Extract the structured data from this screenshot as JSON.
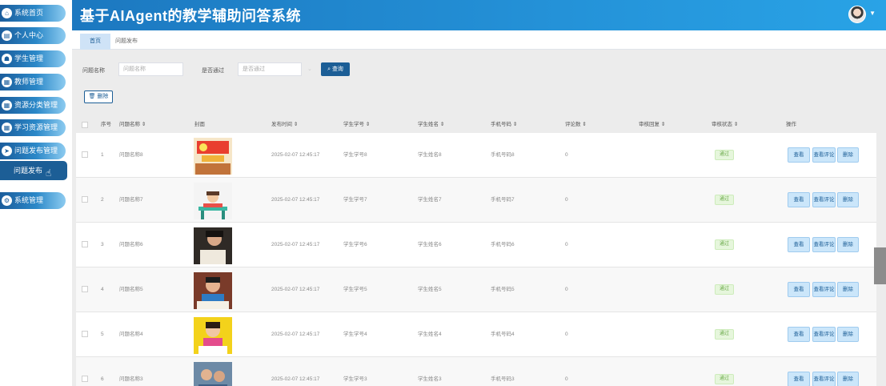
{
  "app": {
    "title": "基于AIAgent的教学辅助问答系统"
  },
  "sidebar": {
    "items": [
      {
        "label": "系统首页",
        "icon": "home-icon"
      },
      {
        "label": "个人中心",
        "icon": "user-icon"
      },
      {
        "label": "学生管理",
        "icon": "student-icon"
      },
      {
        "label": "教师管理",
        "icon": "grid-icon"
      },
      {
        "label": "资源分类管理",
        "icon": "grid-icon"
      },
      {
        "label": "学习资源管理",
        "icon": "grid-icon"
      },
      {
        "label": "问题发布管理",
        "icon": "send-icon"
      },
      {
        "label": "系统管理",
        "icon": "settings-icon"
      }
    ],
    "subitem": "问题发布"
  },
  "tabs": [
    {
      "label": "首页",
      "active": true
    },
    {
      "label": "问题发布",
      "active": false
    }
  ],
  "search": {
    "name_label": "问题名称",
    "name_placeholder": "问题名称",
    "pass_label": "是否通过",
    "pass_placeholder": "是否通过",
    "query_button": "查询",
    "delete_button": "删除"
  },
  "table": {
    "headers": {
      "index": "序号",
      "name": "问题名称",
      "cover": "封面",
      "time": "发布时间",
      "sid": "学生学号",
      "sname": "学生姓名",
      "phone": "手机号码",
      "comments": "评论数",
      "reply": "审核回复",
      "status": "审核状态",
      "actions": "操作"
    },
    "actions": {
      "view": "查看",
      "view_comments": "查看评论",
      "delete": "删除"
    },
    "rows": [
      {
        "index": "1",
        "name": "问题名称8",
        "time": "2025-02-07 12:45:17",
        "sid": "学生学号8",
        "sname": "学生姓名8",
        "phone": "手机号码8",
        "comments": "0",
        "status": "通过",
        "thumb": "study"
      },
      {
        "index": "2",
        "name": "问题名称7",
        "time": "2025-02-07 12:45:17",
        "sid": "学生学号7",
        "sname": "学生姓名7",
        "phone": "手机号码7",
        "comments": "0",
        "status": "通过",
        "thumb": "desk"
      },
      {
        "index": "3",
        "name": "问题名称6",
        "time": "2025-02-07 12:45:17",
        "sid": "学生学号6",
        "sname": "学生姓名6",
        "phone": "手机号码6",
        "comments": "0",
        "status": "通过",
        "thumb": "reading"
      },
      {
        "index": "4",
        "name": "问题名称5",
        "time": "2025-02-07 12:45:17",
        "sid": "学生学号5",
        "sname": "学生姓名5",
        "phone": "手机号码5",
        "comments": "0",
        "status": "通过",
        "thumb": "boy"
      },
      {
        "index": "5",
        "name": "问题名称4",
        "time": "2025-02-07 12:45:17",
        "sid": "学生学号4",
        "sname": "学生姓名4",
        "phone": "手机号码4",
        "comments": "0",
        "status": "通过",
        "thumb": "yellow"
      },
      {
        "index": "6",
        "name": "问题名称3",
        "time": "2025-02-07 12:45:17",
        "sid": "学生学号3",
        "sname": "学生姓名3",
        "phone": "手机号码3",
        "comments": "0",
        "status": "通过",
        "thumb": "class"
      }
    ]
  },
  "colors": {
    "primary": "#1c5e96",
    "header": "#2492d8",
    "success": "#67a846"
  }
}
